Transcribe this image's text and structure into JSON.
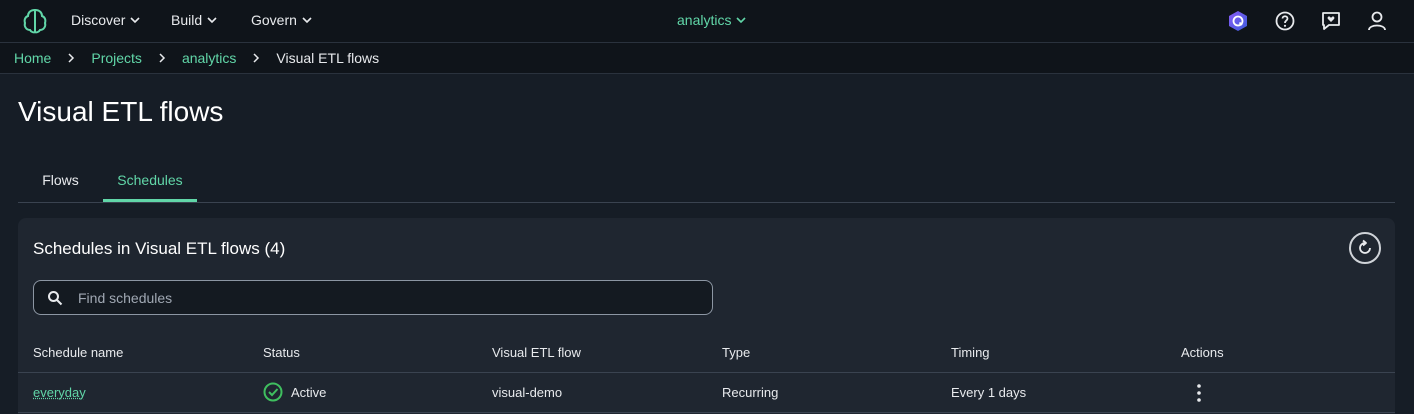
{
  "topnav": {
    "logo_icon": "sagemaker-brain-icon",
    "menus": [
      {
        "label": "Discover"
      },
      {
        "label": "Build"
      },
      {
        "label": "Govern"
      }
    ],
    "project_selector": "analytics",
    "icons": [
      "q-assistant-icon",
      "help-icon",
      "feedback-icon",
      "user-profile-icon"
    ]
  },
  "breadcrumb": {
    "items": [
      "Home",
      "Projects",
      "analytics"
    ],
    "current": "Visual ETL flows"
  },
  "page": {
    "title": "Visual ETL flows",
    "tabs": [
      {
        "label": "Flows",
        "active": false
      },
      {
        "label": "Schedules",
        "active": true
      }
    ]
  },
  "panel": {
    "title": "Schedules in Visual ETL flows (4)",
    "search_placeholder": "Find schedules",
    "search_value": "",
    "columns": [
      "Schedule name",
      "Status",
      "Visual ETL flow",
      "Type",
      "Timing",
      "Actions"
    ],
    "rows": [
      {
        "name": "everyday",
        "status": "Active",
        "flow": "visual-demo",
        "type": "Recurring",
        "timing": "Every 1 days"
      }
    ]
  },
  "colors": {
    "accent": "#61d6a8",
    "background": "#161d26",
    "nav_background": "#0f141a",
    "panel_background": "#1f2630",
    "status_active": "#3fbf5f"
  }
}
